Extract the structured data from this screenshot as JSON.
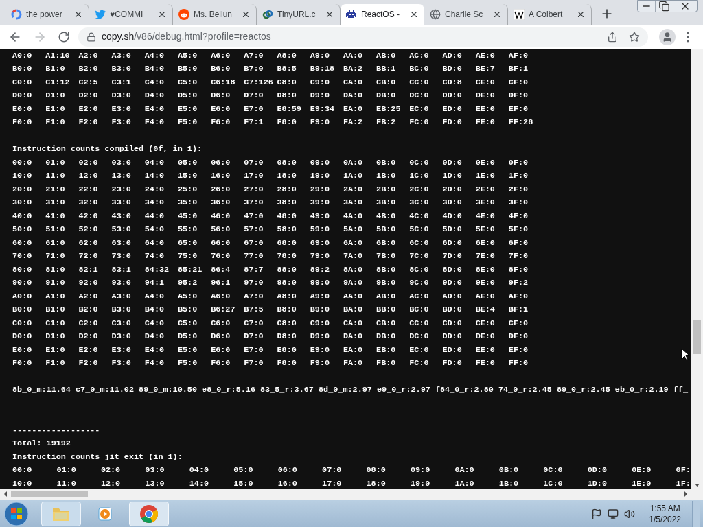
{
  "browser": {
    "tabs": [
      {
        "title": "the power",
        "kind": "google",
        "selected": false
      },
      {
        "title": "♥COMMI",
        "kind": "bird",
        "selected": false
      },
      {
        "title": "Ms. Bellun",
        "kind": "reddit",
        "selected": false
      },
      {
        "title": "TinyURL.c",
        "kind": "tinyurl",
        "selected": false
      },
      {
        "title": "ReactOS -",
        "kind": "invader",
        "selected": true
      },
      {
        "title": "Charlie Sc",
        "kind": "globe",
        "selected": false
      },
      {
        "title": "A Colbert",
        "kind": "wiki",
        "selected": false
      }
    ],
    "address": {
      "host": "copy.sh",
      "path": "/v86/debug.html?profile=reactos"
    }
  },
  "console": {
    "blocks": [
      {
        "kind": "grid",
        "rows": [
          [
            "A0:0",
            "A1:10",
            "A2:0",
            "A3:0",
            "A4:0",
            "A5:0",
            "A6:0",
            "A7:0",
            "A8:0",
            "A9:0",
            "AA:0",
            "AB:0",
            "AC:0",
            "AD:0",
            "AE:0",
            "AF:0"
          ],
          [
            "B0:0",
            "B1:0",
            "B2:0",
            "B3:0",
            "B4:0",
            "B5:0",
            "B6:0",
            "B7:0",
            "B8:5",
            "B9:18",
            "BA:2",
            "BB:1",
            "BC:0",
            "BD:0",
            "BE:7",
            "BF:1"
          ],
          [
            "C0:0",
            "C1:12",
            "C2:5",
            "C3:1",
            "C4:0",
            "C5:0",
            "C6:18",
            "C7:126",
            "C8:0",
            "C9:0",
            "CA:0",
            "CB:0",
            "CC:0",
            "CD:8",
            "CE:0",
            "CF:0"
          ],
          [
            "D0:0",
            "D1:0",
            "D2:0",
            "D3:0",
            "D4:0",
            "D5:0",
            "D6:0",
            "D7:0",
            "D8:0",
            "D9:0",
            "DA:0",
            "DB:0",
            "DC:0",
            "DD:0",
            "DE:0",
            "DF:0"
          ],
          [
            "E0:0",
            "E1:0",
            "E2:0",
            "E3:0",
            "E4:0",
            "E5:0",
            "E6:0",
            "E7:0",
            "E8:59",
            "E9:34",
            "EA:0",
            "EB:25",
            "EC:0",
            "ED:0",
            "EE:0",
            "EF:0"
          ],
          [
            "F0:0",
            "F1:0",
            "F2:0",
            "F3:0",
            "F4:0",
            "F5:0",
            "F6:0",
            "F7:1",
            "F8:0",
            "F9:0",
            "FA:2",
            "FB:2",
            "FC:0",
            "FD:0",
            "FE:0",
            "FF:28"
          ]
        ]
      },
      {
        "kind": "blank"
      },
      {
        "kind": "text",
        "text": "Instruction counts compiled (0f, in 1):"
      },
      {
        "kind": "grid",
        "rows": [
          [
            "00:0",
            "01:0",
            "02:0",
            "03:0",
            "04:0",
            "05:0",
            "06:0",
            "07:0",
            "08:0",
            "09:0",
            "0A:0",
            "0B:0",
            "0C:0",
            "0D:0",
            "0E:0",
            "0F:0"
          ],
          [
            "10:0",
            "11:0",
            "12:0",
            "13:0",
            "14:0",
            "15:0",
            "16:0",
            "17:0",
            "18:0",
            "19:0",
            "1A:0",
            "1B:0",
            "1C:0",
            "1D:0",
            "1E:0",
            "1F:0"
          ],
          [
            "20:0",
            "21:0",
            "22:0",
            "23:0",
            "24:0",
            "25:0",
            "26:0",
            "27:0",
            "28:0",
            "29:0",
            "2A:0",
            "2B:0",
            "2C:0",
            "2D:0",
            "2E:0",
            "2F:0"
          ],
          [
            "30:0",
            "31:0",
            "32:0",
            "33:0",
            "34:0",
            "35:0",
            "36:0",
            "37:0",
            "38:0",
            "39:0",
            "3A:0",
            "3B:0",
            "3C:0",
            "3D:0",
            "3E:0",
            "3F:0"
          ],
          [
            "40:0",
            "41:0",
            "42:0",
            "43:0",
            "44:0",
            "45:0",
            "46:0",
            "47:0",
            "48:0",
            "49:0",
            "4A:0",
            "4B:0",
            "4C:0",
            "4D:0",
            "4E:0",
            "4F:0"
          ],
          [
            "50:0",
            "51:0",
            "52:0",
            "53:0",
            "54:0",
            "55:0",
            "56:0",
            "57:0",
            "58:0",
            "59:0",
            "5A:0",
            "5B:0",
            "5C:0",
            "5D:0",
            "5E:0",
            "5F:0"
          ],
          [
            "60:0",
            "61:0",
            "62:0",
            "63:0",
            "64:0",
            "65:0",
            "66:0",
            "67:0",
            "68:0",
            "69:0",
            "6A:0",
            "6B:0",
            "6C:0",
            "6D:0",
            "6E:0",
            "6F:0"
          ],
          [
            "70:0",
            "71:0",
            "72:0",
            "73:0",
            "74:0",
            "75:0",
            "76:0",
            "77:0",
            "78:0",
            "79:0",
            "7A:0",
            "7B:0",
            "7C:0",
            "7D:0",
            "7E:0",
            "7F:0"
          ],
          [
            "80:0",
            "81:0",
            "82:1",
            "83:1",
            "84:32",
            "85:21",
            "86:4",
            "87:7",
            "88:0",
            "89:2",
            "8A:0",
            "8B:0",
            "8C:0",
            "8D:0",
            "8E:0",
            "8F:0"
          ],
          [
            "90:0",
            "91:0",
            "92:0",
            "93:0",
            "94:1",
            "95:2",
            "96:1",
            "97:0",
            "98:0",
            "99:0",
            "9A:0",
            "9B:0",
            "9C:0",
            "9D:0",
            "9E:0",
            "9F:2"
          ],
          [
            "A0:0",
            "A1:0",
            "A2:0",
            "A3:0",
            "A4:0",
            "A5:0",
            "A6:0",
            "A7:0",
            "A8:0",
            "A9:0",
            "AA:0",
            "AB:0",
            "AC:0",
            "AD:0",
            "AE:0",
            "AF:0"
          ],
          [
            "B0:0",
            "B1:0",
            "B2:0",
            "B3:0",
            "B4:0",
            "B5:0",
            "B6:27",
            "B7:5",
            "B8:0",
            "B9:0",
            "BA:0",
            "BB:0",
            "BC:0",
            "BD:0",
            "BE:4",
            "BF:1"
          ],
          [
            "C0:0",
            "C1:0",
            "C2:0",
            "C3:0",
            "C4:0",
            "C5:0",
            "C6:0",
            "C7:0",
            "C8:0",
            "C9:0",
            "CA:0",
            "CB:0",
            "CC:0",
            "CD:0",
            "CE:0",
            "CF:0"
          ],
          [
            "D0:0",
            "D1:0",
            "D2:0",
            "D3:0",
            "D4:0",
            "D5:0",
            "D6:0",
            "D7:0",
            "D8:0",
            "D9:0",
            "DA:0",
            "DB:0",
            "DC:0",
            "DD:0",
            "DE:0",
            "DF:0"
          ],
          [
            "E0:0",
            "E1:0",
            "E2:0",
            "E3:0",
            "E4:0",
            "E5:0",
            "E6:0",
            "E7:0",
            "E8:0",
            "E9:0",
            "EA:0",
            "EB:0",
            "EC:0",
            "ED:0",
            "EE:0",
            "EF:0"
          ],
          [
            "F0:0",
            "F1:0",
            "F2:0",
            "F3:0",
            "F4:0",
            "F5:0",
            "F6:0",
            "F7:0",
            "F8:0",
            "F9:0",
            "FA:0",
            "FB:0",
            "FC:0",
            "FD:0",
            "FE:0",
            "FF:0"
          ]
        ]
      },
      {
        "kind": "blank"
      },
      {
        "kind": "text",
        "text": "8b_0_m:11.64 c7_0_m:11.02 89_0_m:10.50 e8_0_r:5.16 83_5_r:3.67 8d_0_m:2.97 e9_0_r:2.97 f84_0_r:2.80 74_0_r:2.45 89_0_r:2.45 eb_0_r:2.19 ff_"
      },
      {
        "kind": "blank"
      },
      {
        "kind": "blank"
      },
      {
        "kind": "text",
        "text": "------------------"
      },
      {
        "kind": "text",
        "text": "Total: 19192"
      },
      {
        "kind": "text",
        "text": "Instruction counts jit exit (in 1):"
      },
      {
        "kind": "wide_grid",
        "rows": [
          [
            "00:0",
            "01:0",
            "02:0",
            "03:0",
            "04:0",
            "05:0",
            "06:0",
            "07:0",
            "08:0",
            "09:0",
            "0A:0",
            "0B:0",
            "0C:0",
            "0D:0",
            "0E:0",
            "0F:"
          ],
          [
            "10:0",
            "11:0",
            "12:0",
            "13:0",
            "14:0",
            "15:0",
            "16:0",
            "17:0",
            "18:0",
            "19:0",
            "1A:0",
            "1B:0",
            "1C:0",
            "1D:0",
            "1E:0",
            "1F:"
          ]
        ]
      }
    ]
  },
  "taskbar": {
    "apps": [
      {
        "kind": "folder"
      },
      {
        "kind": "media"
      },
      {
        "kind": "chrome"
      }
    ],
    "clock": {
      "time": "1:55 AM",
      "date": "1/5/2022"
    }
  }
}
